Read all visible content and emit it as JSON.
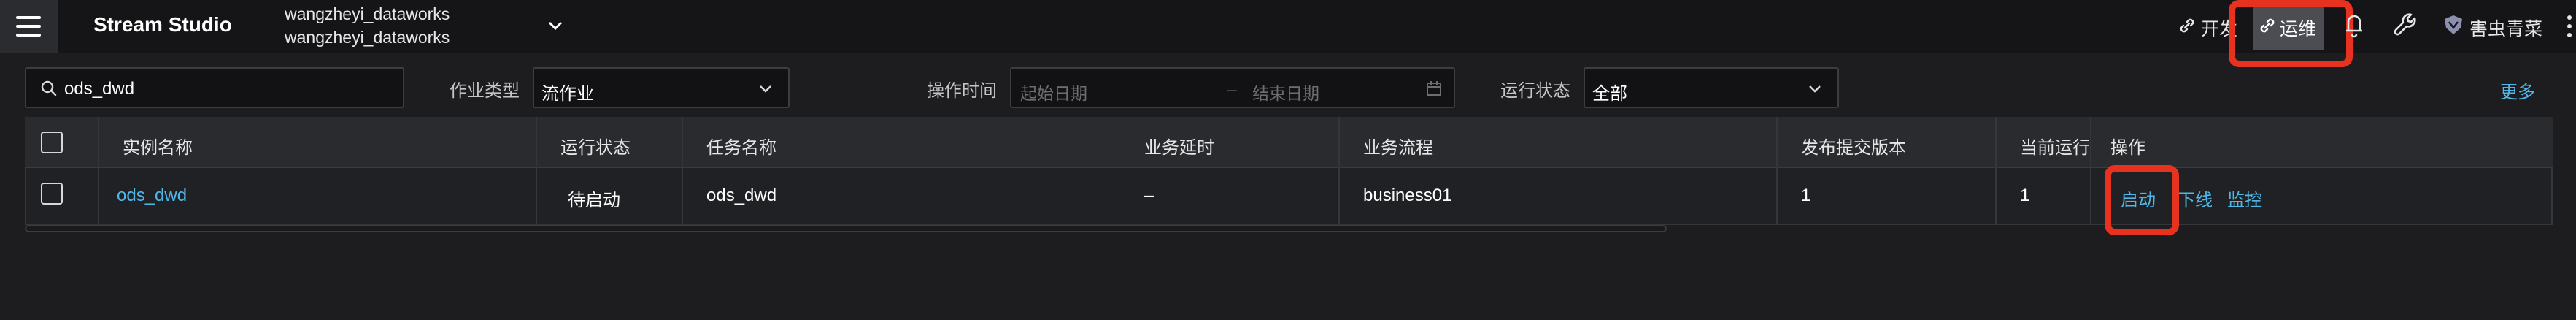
{
  "topbar": {
    "app_title": "Stream Studio",
    "workspace_line1": "wangzheyi_dataworks",
    "workspace_line2": "wangzheyi_dataworks",
    "dev_label": "开发",
    "ops_label": "运维",
    "user_name": "害虫青菜"
  },
  "filters": {
    "search_value": "ods_dwd",
    "job_type_label": "作业类型",
    "job_type_value": "流作业",
    "op_time_label": "操作时间",
    "start_date_placeholder": "起始日期",
    "date_separator": "–",
    "end_date_placeholder": "结束日期",
    "run_status_label": "运行状态",
    "run_status_value": "全部",
    "more_label": "更多"
  },
  "table": {
    "columns": [
      "实例名称",
      "运行状态",
      "任务名称",
      "业务延时",
      "业务流程",
      "发布提交版本",
      "当前运行",
      "操作"
    ],
    "rows": [
      {
        "instance_name": "ods_dwd",
        "run_status": "待启动",
        "task_name": "ods_dwd",
        "business_delay": "–",
        "business_flow": "business01",
        "published_version": "1",
        "current_run": "1",
        "actions": [
          "启动",
          "下线",
          "监控"
        ]
      }
    ]
  },
  "colors": {
    "accent_link": "#4fb8e8",
    "highlight_box": "#e7321f",
    "topbar_bg": "#151517"
  }
}
